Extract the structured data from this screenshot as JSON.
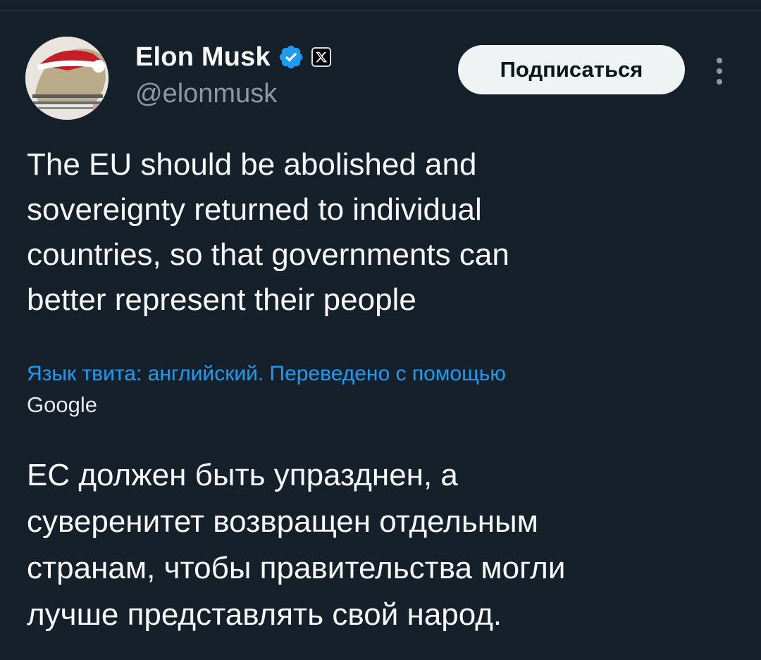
{
  "author": {
    "name": "Elon Musk",
    "handle": "@elonmusk",
    "verified_icon": "verified-badge-icon",
    "affiliate_icon": "x-logo-icon"
  },
  "actions": {
    "subscribe_label": "Подписаться",
    "more_icon": "more-vertical-icon"
  },
  "tweet": {
    "text": "The EU should be abolished and\nsovereignty returned to individual\ncountries, so that governments can\nbetter represent their people",
    "translation_note": "Язык твита: английский. Переведено с помощью",
    "translation_provider": "Google",
    "translated_text": "ЕС должен быть упразднен, а\nсуверенитет возвращен отдельным\nстранам, чтобы правительства могли\nлучше представлять свой народ."
  },
  "colors": {
    "background": "#15202b",
    "primary_text": "#f7f9f9",
    "secondary_text": "#8b98a5",
    "link": "#1d9bf0",
    "verified_badge": "#1d9bf0",
    "button_bg": "#eff3f4",
    "button_text": "#0f1419"
  }
}
